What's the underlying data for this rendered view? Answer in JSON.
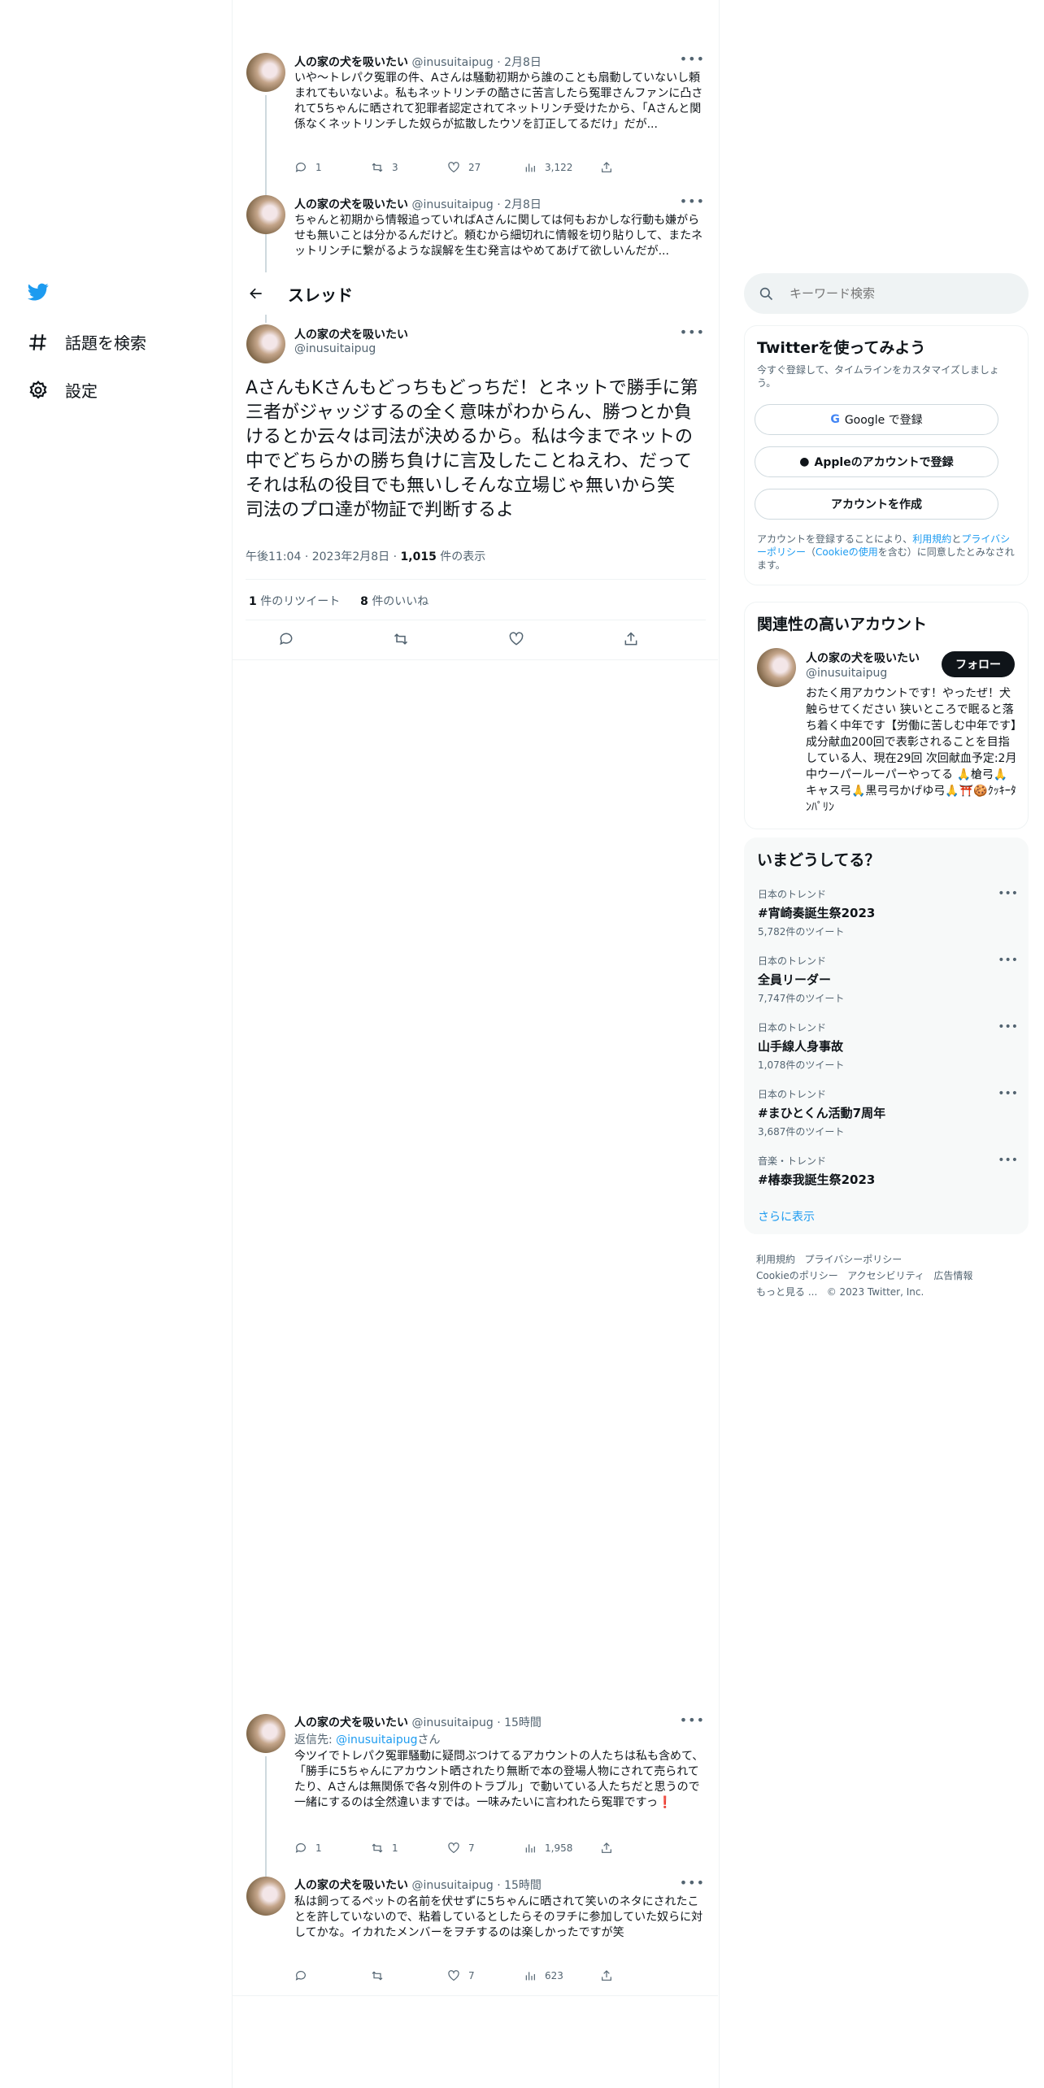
{
  "nav": {
    "explore_label": "話題を検索",
    "settings_label": "設定"
  },
  "header": {
    "title": "スレッド"
  },
  "search": {
    "placeholder": "キーワード検索"
  },
  "tweets_top": [
    {
      "name": "人の家の犬を吸いたい",
      "handle": "@inusuitaipug",
      "date": "2月8日",
      "text": "いや〜トレパク冤罪の件、Aさんは騒動初期から誰のことも扇動していないし頼まれてもいないよ。私もネットリンチの酷さに苦言したら冤罪さんファンに凸されて5ちゃんに晒されて犯罪者認定されてネットリンチ受けたから、「Aさんと関係なくネットリンチした奴らが拡散したウソを訂正してるだけ」だが...",
      "replies": "1",
      "retweets": "3",
      "likes": "27",
      "views": "3,122"
    },
    {
      "name": "人の家の犬を吸いたい",
      "handle": "@inusuitaipug",
      "date": "2月8日",
      "text": "ちゃんと初期から情報追っていればAさんに関しては何もおかしな行動も嫌がらせも無いことは分かるんだけど。頼むから細切れに情報を切り貼りして、またネットリンチに繋がるような誤解を生む発言はやめてあげて欲しいんだが..."
    }
  ],
  "main_tweet": {
    "name": "人の家の犬を吸いたい",
    "handle": "@inusuitaipug",
    "text": "AさんもKさんもどっちもどっちだ！とネットで勝手に第三者がジャッジするの全く意味がわからん、勝つとか負けるとか云々は司法が決めるから。私は今までネットの中でどちらかの勝ち負けに言及したことねえわ、だってそれは私の役目でも無いしそんな立場じゃ無いから笑\n司法のプロ達が物証で判断するよ",
    "time": "午後11:04",
    "date": "2023年2月8日",
    "views_count": "1,015",
    "views_label": "件の表示",
    "retweets_count": "1",
    "retweets_label": "件のリツイート",
    "likes_count": "8",
    "likes_label": "件のいいね"
  },
  "tweets_bottom": [
    {
      "name": "人の家の犬を吸いたい",
      "handle": "@inusuitaipug",
      "date": "15時間",
      "reply_prefix": "返信先: ",
      "reply_to": "@inusuitaipug",
      "reply_suffix": "さん",
      "text": "今ツイでトレパク冤罪騒動に疑問ぶつけてるアカウントの人たちは私も含めて、「勝手に5ちゃんにアカウント晒されたり無断で本の登場人物にされて売られてたり、Aさんは無関係で各々別件のトラブル」で動いている人たちだと思うので一緒にするのは全然違いますでは。一味みたいに言われたら冤罪ですっ❗️",
      "replies": "1",
      "retweets": "1",
      "likes": "7",
      "views": "1,958"
    },
    {
      "name": "人の家の犬を吸いたい",
      "handle": "@inusuitaipug",
      "date": "15時間",
      "text": "私は飼ってるペットの名前を伏せずに5ちゃんに晒されて笑いのネタにされたことを許していないので、粘着しているとしたらそのヲチに参加していた奴らに対してかな。イカれたメンバーをヲチするのは楽しかったですが笑",
      "replies": "",
      "retweets": "",
      "likes": "7",
      "views": "623"
    }
  ],
  "signup": {
    "title": "Twitterを使ってみよう",
    "desc": "今すぐ登録して、タイムラインをカスタマイズしましょう。",
    "google_label": "Google で登録",
    "apple_label": "Appleのアカウントで登録",
    "create_label": "アカウントを作成",
    "terms_1": "アカウントを登録することにより、",
    "terms_link1": "利用規約",
    "terms_2": "と",
    "terms_link2": "プライバシーポリシー",
    "terms_3": "（",
    "terms_link3": "Cookieの使用",
    "terms_4": "を含む）に同意したとみなされます。"
  },
  "related": {
    "title": "関連性の高いアカウント",
    "name": "人の家の犬を吸いたい",
    "handle": "@inusuitaipug",
    "follow_label": "フォロー",
    "bio": "おたく用アカウントです！やったぜ！犬触らせてください 狭いところで眠ると落ち着く中年です【労働に苦しむ中年です】成分献血200回で表彰されることを目指している人、現在29回 次回献血予定:2月中ウーパールーパーやってる 🙏槍弓🙏キャス弓🙏黒弓弓かげゆ弓🙏⛩️🍪ｸｯｷｰﾀﾝﾊﾟﾘﾝ"
  },
  "trends": {
    "title": "いまどうしてる？",
    "items": [
      {
        "category": "日本のトレンド",
        "title": "#宵崎奏誕生祭2023",
        "count": "5,782件のツイート"
      },
      {
        "category": "日本のトレンド",
        "title": "全員リーダー",
        "count": "7,747件のツイート"
      },
      {
        "category": "日本のトレンド",
        "title": "山手線人身事故",
        "count": "1,078件のツイート"
      },
      {
        "category": "日本のトレンド",
        "title": "#まひとくん活動7周年",
        "count": "3,687件のツイート"
      },
      {
        "category": "音楽・トレンド",
        "title": "#椿泰我誕生祭2023",
        "count": ""
      }
    ],
    "show_more": "さらに表示"
  },
  "footer": {
    "terms": "利用規約",
    "privacy": "プライバシーポリシー",
    "cookie": "Cookieのポリシー",
    "accessibility": "アクセシビリティ",
    "ads": "広告情報",
    "more": "もっと見る ...",
    "copyright": "© 2023 Twitter, Inc."
  },
  "colors": {
    "accent": "#1d9bf0",
    "text": "#0f1419",
    "muted": "#536471"
  }
}
